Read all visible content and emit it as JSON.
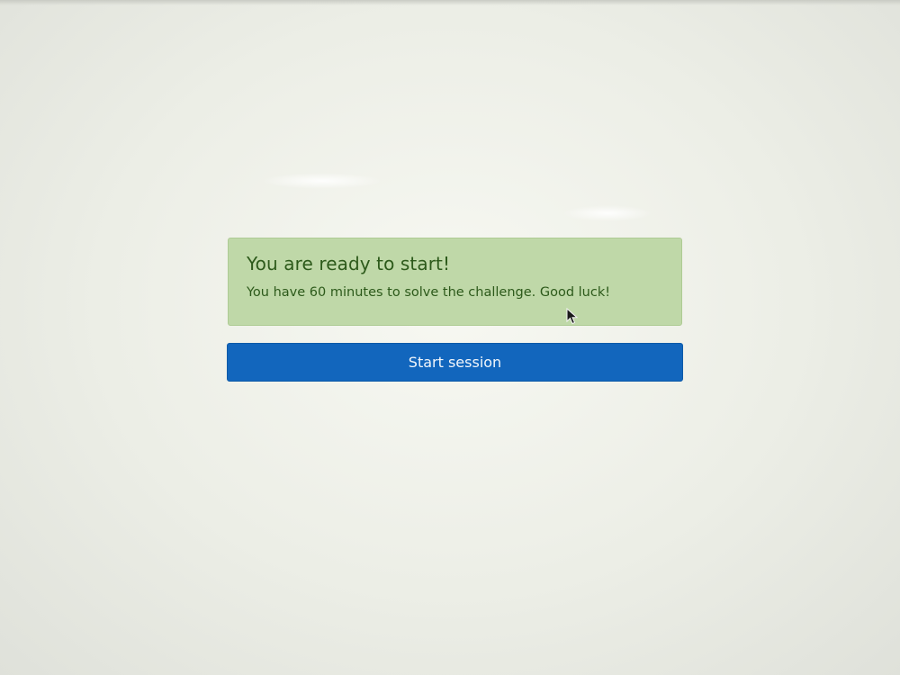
{
  "alert": {
    "heading": "You are ready to start!",
    "message": "You have 60 minutes to solve the challenge. Good luck!"
  },
  "actions": {
    "start_label": "Start session"
  },
  "colors": {
    "alert_background": "#bfd8a8",
    "alert_text": "#2d5a1b",
    "button_background": "#1266bd",
    "button_text": "#f2f6fb"
  },
  "icons": {
    "cursor": "mouse-pointer-icon"
  }
}
